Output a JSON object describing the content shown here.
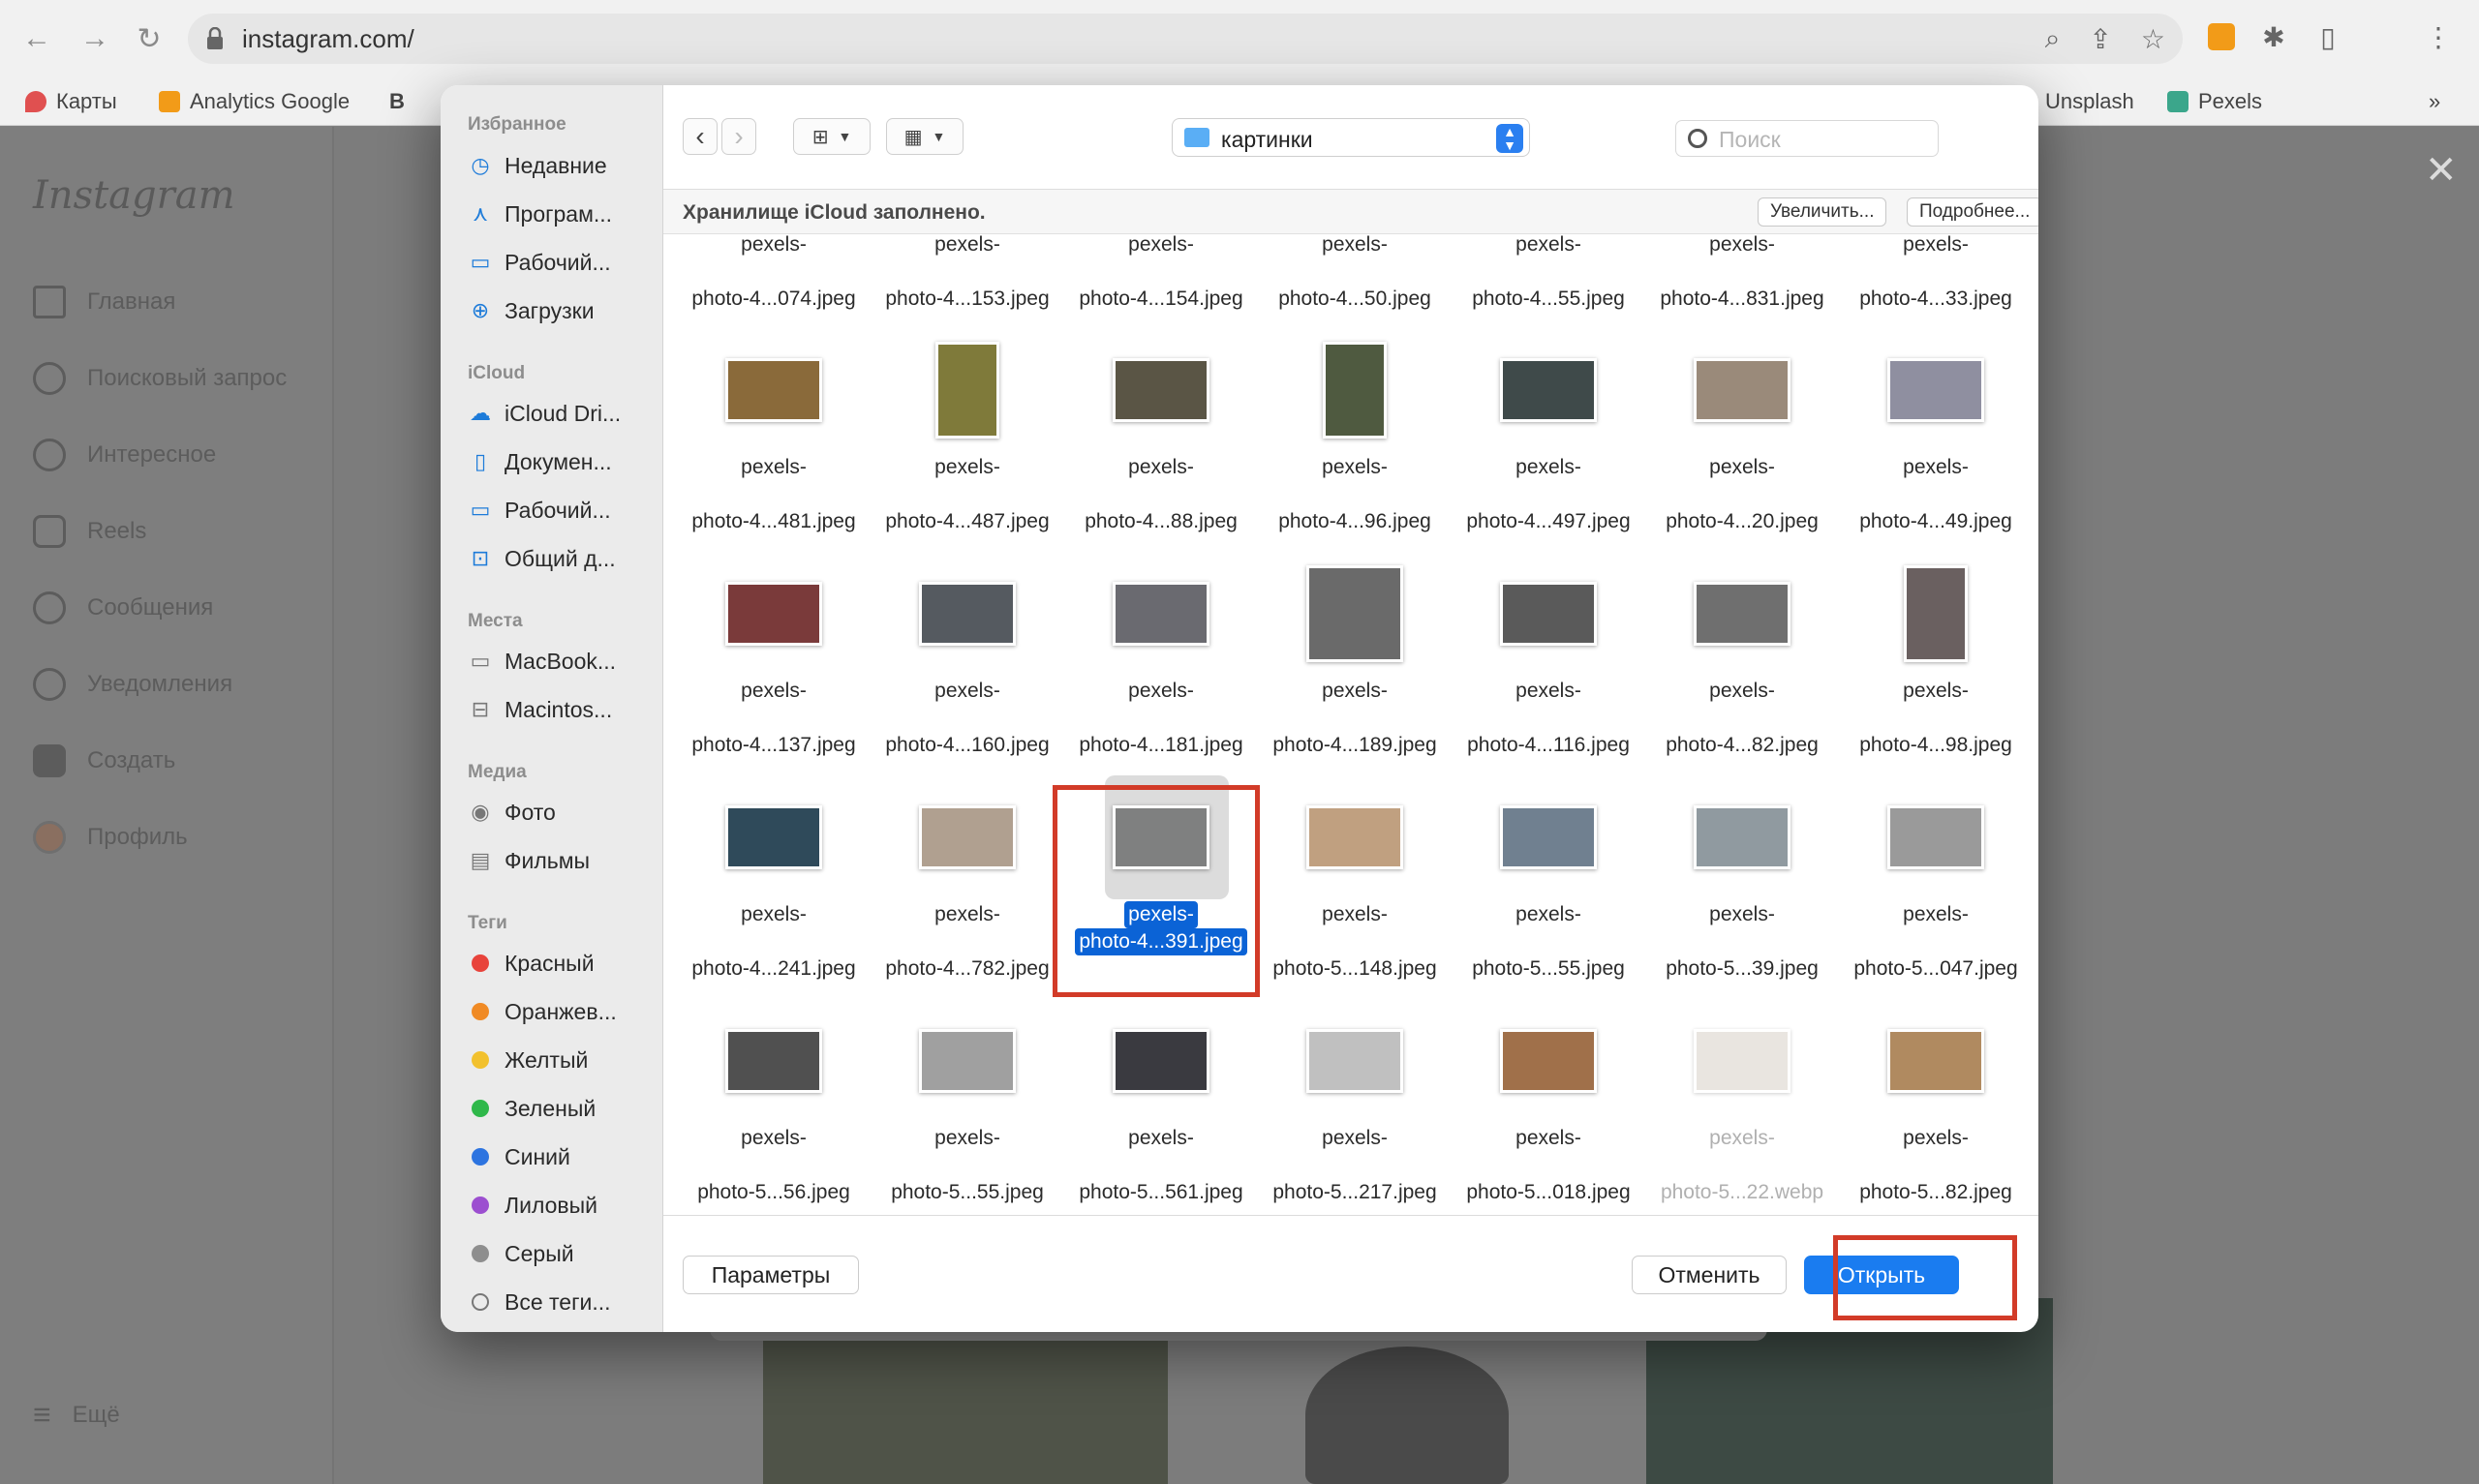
{
  "browser": {
    "url": "instagram.com/",
    "bookmarks": [
      {
        "label": "Карты",
        "color": "#e05050"
      },
      {
        "label": "Analytics Google",
        "color": "#f29b18"
      },
      {
        "label": "B",
        "color": "#333333"
      },
      {
        "label": "Unsplash",
        "color": "#555555"
      },
      {
        "label": "Pexels",
        "color": "#3ba68b"
      }
    ],
    "more": "»"
  },
  "instagram": {
    "logo": "Instagram",
    "nav": [
      "Главная",
      "Поисковый запрос",
      "Интересное",
      "Reels",
      "Сообщения",
      "Уведомления",
      "Создать",
      "Профиль"
    ],
    "more": "Ещё",
    "close": "✕"
  },
  "dialog": {
    "sidebar": {
      "favorites_title": "Избранное",
      "favorites": [
        "Недавние",
        "Програм...",
        "Рабочий...",
        "Загрузки"
      ],
      "icloud_title": "iCloud",
      "icloud": [
        "iCloud Dri...",
        "Докумен...",
        "Рабочий...",
        "Общий д..."
      ],
      "places_title": "Места",
      "places": [
        "MacBook...",
        "Macintos..."
      ],
      "media_title": "Медиа",
      "media": [
        "Фото",
        "Фильмы"
      ],
      "tags_title": "Теги",
      "tags": [
        {
          "label": "Красный",
          "color": "#e8433b"
        },
        {
          "label": "Оранжев...",
          "color": "#f08a24"
        },
        {
          "label": "Желтый",
          "color": "#f2c12e"
        },
        {
          "label": "Зеленый",
          "color": "#2fb84a"
        },
        {
          "label": "Синий",
          "color": "#2d74e0"
        },
        {
          "label": "Лиловый",
          "color": "#9c4fd0"
        },
        {
          "label": "Серый",
          "color": "#8e8e8e"
        },
        {
          "label": "Все теги..."
        }
      ]
    },
    "toolbar": {
      "back": "‹",
      "forward": "›",
      "folder": "картинки",
      "search_placeholder": "Поиск"
    },
    "icloud_bar": {
      "message": "Хранилище iCloud заполнено.",
      "upgrade": "Увеличить...",
      "details": "Подробнее..."
    },
    "files": [
      {
        "l1": "pexels-",
        "l2": "photo-4...074.jpeg"
      },
      {
        "l1": "pexels-",
        "l2": "photo-4...153.jpeg"
      },
      {
        "l1": "pexels-",
        "l2": "photo-4...154.jpeg"
      },
      {
        "l1": "pexels-",
        "l2": "photo-4...50.jpeg"
      },
      {
        "l1": "pexels-",
        "l2": "photo-4...55.jpeg"
      },
      {
        "l1": "pexels-",
        "l2": "photo-4...831.jpeg"
      },
      {
        "l1": "pexels-",
        "l2": "photo-4...33.jpeg"
      },
      {
        "l1": "pexels-",
        "l2": "photo-4...481.jpeg"
      },
      {
        "l1": "pexels-",
        "l2": "photo-4...487.jpeg"
      },
      {
        "l1": "pexels-",
        "l2": "photo-4...88.jpeg"
      },
      {
        "l1": "pexels-",
        "l2": "photo-4...96.jpeg"
      },
      {
        "l1": "pexels-",
        "l2": "photo-4...497.jpeg"
      },
      {
        "l1": "pexels-",
        "l2": "photo-4...20.jpeg"
      },
      {
        "l1": "pexels-",
        "l2": "photo-4...49.jpeg"
      },
      {
        "l1": "pexels-",
        "l2": "photo-4...137.jpeg"
      },
      {
        "l1": "pexels-",
        "l2": "photo-4...160.jpeg"
      },
      {
        "l1": "pexels-",
        "l2": "photo-4...181.jpeg"
      },
      {
        "l1": "pexels-",
        "l2": "photo-4...189.jpeg"
      },
      {
        "l1": "pexels-",
        "l2": "photo-4...116.jpeg"
      },
      {
        "l1": "pexels-",
        "l2": "photo-4...82.jpeg"
      },
      {
        "l1": "pexels-",
        "l2": "photo-4...98.jpeg"
      },
      {
        "l1": "pexels-",
        "l2": "photo-4...241.jpeg"
      },
      {
        "l1": "pexels-",
        "l2": "photo-4...782.jpeg"
      },
      {
        "l1": "pexels-",
        "l2": "photo-4...391.jpeg",
        "selected": true
      },
      {
        "l1": "pexels-",
        "l2": "photo-5...148.jpeg"
      },
      {
        "l1": "pexels-",
        "l2": "photo-5...55.jpeg"
      },
      {
        "l1": "pexels-",
        "l2": "photo-5...39.jpeg"
      },
      {
        "l1": "pexels-",
        "l2": "photo-5...047.jpeg"
      },
      {
        "l1": "pexels-",
        "l2": "photo-5...56.jpeg"
      },
      {
        "l1": "pexels-",
        "l2": "photo-5...55.jpeg"
      },
      {
        "l1": "pexels-",
        "l2": "photo-5...561.jpeg"
      },
      {
        "l1": "pexels-",
        "l2": "photo-5...217.jpeg"
      },
      {
        "l1": "pexels-",
        "l2": "photo-5...018.jpeg"
      },
      {
        "l1": "pexels-",
        "l2": "photo-5...22.webp",
        "disabled": true
      },
      {
        "l1": "pexels-",
        "l2": "photo-5...82.jpeg"
      }
    ],
    "footer": {
      "options": "Параметры",
      "cancel": "Отменить",
      "open": "Открыть"
    }
  },
  "colors": {
    "accent": "#1a7cf0",
    "selection": "#0b63d6",
    "highlight": "#d23b28"
  }
}
